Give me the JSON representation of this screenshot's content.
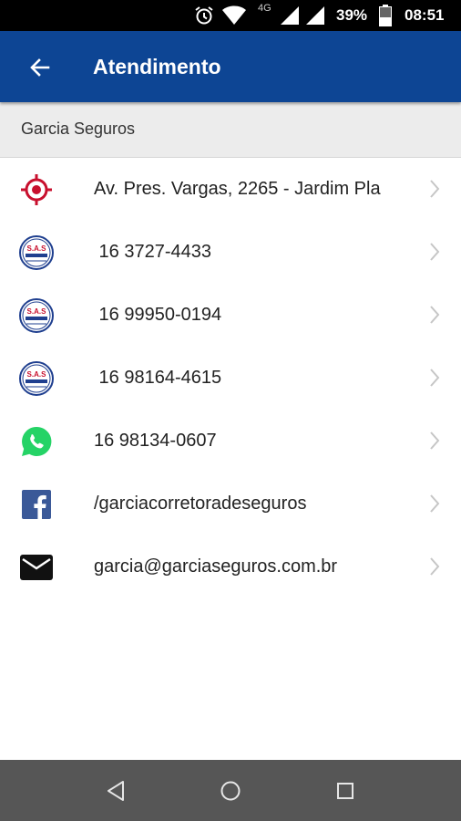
{
  "status_bar": {
    "network": "4G",
    "battery": "39%",
    "time": "08:51"
  },
  "app_bar": {
    "title": "Atendimento"
  },
  "company": {
    "name": "Garcia Seguros"
  },
  "contacts": [
    {
      "icon": "location-target-icon",
      "text": "Av. Pres. Vargas, 2265 - Jardim Pla"
    },
    {
      "icon": "sas-logo-icon",
      "text": " 16 3727-4433"
    },
    {
      "icon": "sas-logo-icon",
      "text": " 16 99950-0194"
    },
    {
      "icon": "sas-logo-icon",
      "text": " 16 98164-4615"
    },
    {
      "icon": "whatsapp-icon",
      "text": "16 98134-0607"
    },
    {
      "icon": "facebook-icon",
      "text": "/garciacorretoradeseguros"
    },
    {
      "icon": "email-icon",
      "text": "garcia@garciaseguros.com.br"
    }
  ],
  "sas_logo_text": "S.A.S",
  "colors": {
    "app_bar": "#0d4594",
    "status_bar": "#000000",
    "nav_bar": "#565656",
    "whatsapp": "#25d366",
    "facebook": "#3b5998",
    "target": "#c8102e"
  }
}
